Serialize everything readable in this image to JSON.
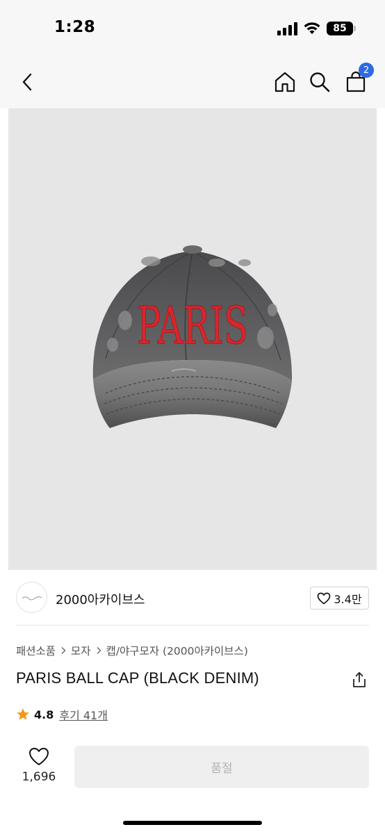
{
  "status_bar": {
    "time": "1:28",
    "battery": "85",
    "icons": [
      "signal-icon",
      "wifi-icon",
      "battery-icon"
    ]
  },
  "nav": {
    "cart_count": "2",
    "icons": [
      "back-arrow-icon",
      "home-icon",
      "search-icon",
      "cart-icon"
    ]
  },
  "hero": {
    "cap_text": "PARIS",
    "colors": {
      "background": "#e6e6e7",
      "denim": "#555556",
      "embroidery": "#d8262c"
    }
  },
  "brand": {
    "name": "2000아카이브스",
    "like_count": "3.4만"
  },
  "breadcrumb": [
    "패션소품",
    "모자",
    "캡/야구모자 (2000아카이브스)"
  ],
  "product": {
    "title": "PARIS BALL CAP (BLACK DENIM)",
    "rating": "4.8",
    "reviews": "후기 41개"
  },
  "bottom_bar": {
    "wish_count": "1,696",
    "soldout_label": "품절"
  },
  "colors": {
    "accent": "#2d6be4",
    "star": "#f29a18",
    "soldout_bg": "#efefef",
    "soldout_text": "#b3b3b3"
  }
}
